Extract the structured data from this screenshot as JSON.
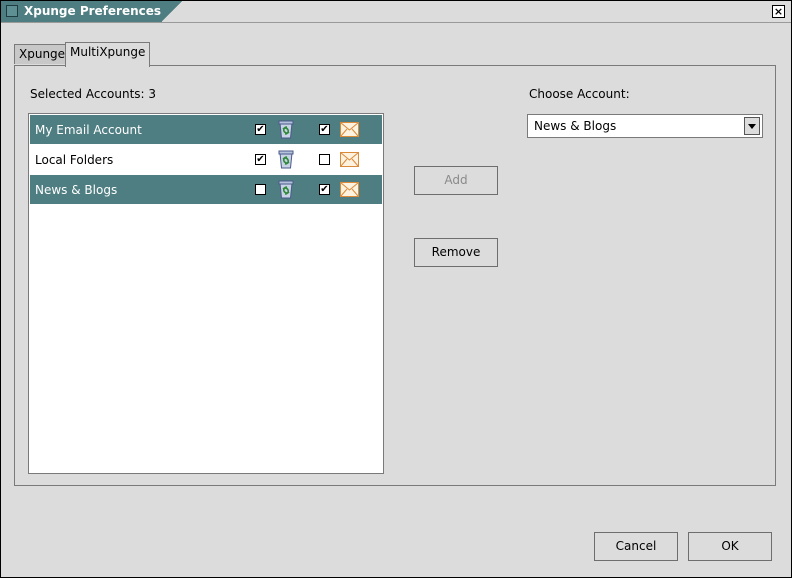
{
  "window": {
    "title": "Xpunge Preferences",
    "close_label": "×"
  },
  "tabs": [
    {
      "label": "Xpunge"
    },
    {
      "label": "MultiXpunge"
    }
  ],
  "selected_accounts_label": "Selected Accounts: 3",
  "choose_account_label": "Choose Account:",
  "accounts": [
    {
      "name": "My Email Account",
      "selected": true,
      "trash_checked": true,
      "junk_checked": true
    },
    {
      "name": "Local Folders",
      "selected": false,
      "trash_checked": true,
      "junk_checked": false
    },
    {
      "name": "News & Blogs",
      "selected": true,
      "trash_checked": false,
      "junk_checked": true
    }
  ],
  "buttons": {
    "add": "Add",
    "remove": "Remove",
    "cancel": "Cancel",
    "ok": "OK"
  },
  "choose_account": {
    "value": "News & Blogs"
  },
  "colors": {
    "selection": "#4f7e82",
    "background": "#dcdcdc"
  },
  "icons": {
    "trash": "recycle-bin-icon",
    "mail": "envelope-icon"
  }
}
